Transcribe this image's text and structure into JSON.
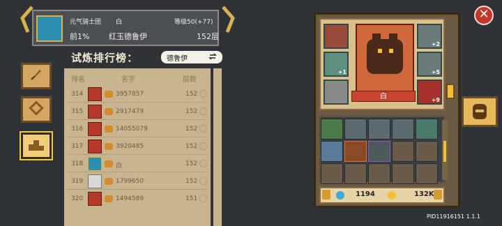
{
  "header": {
    "guild": "元气骑士团",
    "player_name_short": "白",
    "level_text": "等级50(+77)",
    "percent": "前1%",
    "boss_name": "红玉德鲁伊",
    "floor": "152层"
  },
  "ranking": {
    "title": "试炼排行榜：",
    "filter_label": "德鲁伊",
    "columns": [
      "排名",
      "名字",
      "层数"
    ],
    "rows": [
      {
        "rank": "314",
        "name": "3957857",
        "floor": "152"
      },
      {
        "rank": "315",
        "name": "2917479",
        "floor": "152"
      },
      {
        "rank": "316",
        "name": "14055079",
        "floor": "152"
      },
      {
        "rank": "317",
        "name": "3920485",
        "floor": "152"
      },
      {
        "rank": "318",
        "name": "白",
        "floor": "152"
      },
      {
        "rank": "319",
        "name": "1799650",
        "floor": "152"
      },
      {
        "rank": "320",
        "name": "1494589",
        "floor": "151"
      }
    ]
  },
  "character": {
    "name": "白"
  },
  "equipment": {
    "badges": [
      "+1",
      "+2",
      "+5",
      "+9"
    ]
  },
  "currency": {
    "gems": "1194",
    "gold": "132K"
  },
  "footer": {
    "pid": "PID11916151 1.1.1"
  },
  "colors": {
    "background": "#2f3338",
    "list_bg": "#c8b48e",
    "accent_gold": "#f2c030",
    "close_red": "#c8362a"
  },
  "icons": [
    "feather-icon",
    "diamond-icon",
    "podium-icon",
    "helmet-icon",
    "close-icon",
    "swap-icon",
    "magnifier-icon",
    "lock-icon",
    "gem-icon",
    "coin-icon"
  ]
}
